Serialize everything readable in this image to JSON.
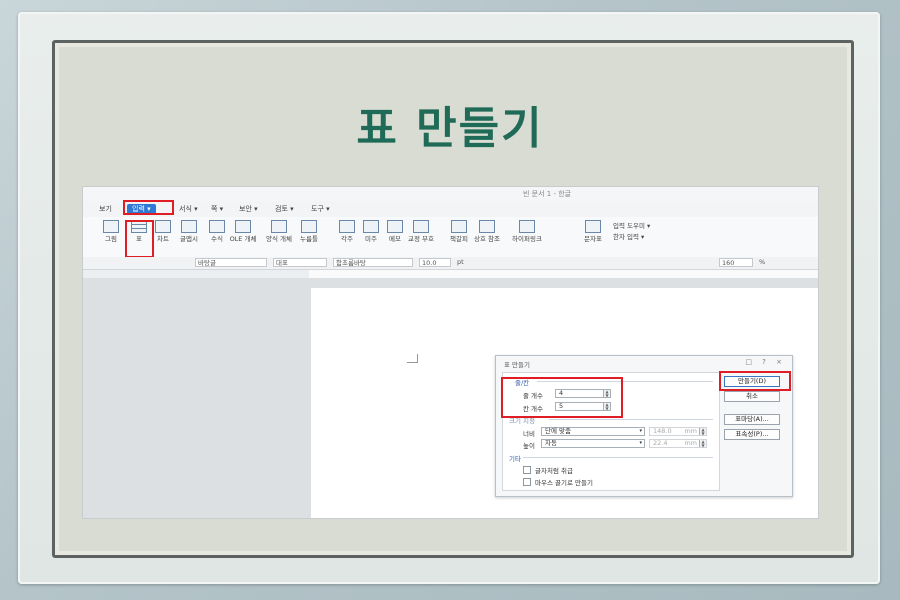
{
  "slide": {
    "title": "표 만들기"
  },
  "window": {
    "title": "빈 문서 1 - 한글"
  },
  "menubar": {
    "items": [
      "보기",
      "입력 ▾",
      "서식 ▾",
      "쪽 ▾",
      "보안 ▾",
      "검토 ▾",
      "도구 ▾"
    ]
  },
  "ribbon": {
    "buttons": [
      {
        "label": "그림",
        "icon": "picture-icon"
      },
      {
        "label": "표",
        "icon": "table-icon"
      },
      {
        "label": "차트",
        "icon": "chart-icon"
      },
      {
        "label": "글맵시",
        "icon": "textart-icon"
      },
      {
        "label": "수식",
        "icon": "formula-icon"
      },
      {
        "label": "OLE 개체",
        "icon": "ole-icon"
      },
      {
        "label": "양식 개체",
        "icon": "form-icon"
      },
      {
        "label": "누름틀",
        "icon": "field-icon"
      },
      {
        "label": "각주",
        "icon": "footnote-icon"
      },
      {
        "label": "미주",
        "icon": "endnote-icon"
      },
      {
        "label": "메모",
        "icon": "memo-icon"
      },
      {
        "label": "교정 부호",
        "icon": "proof-icon"
      },
      {
        "label": "책갈피",
        "icon": "bookmark-icon"
      },
      {
        "label": "상호 참조",
        "icon": "crossref-icon"
      },
      {
        "label": "하이퍼링크",
        "icon": "hyperlink-icon"
      },
      {
        "label": "문자표",
        "icon": "charmap-icon"
      }
    ],
    "side_items": [
      "입력 도우미 ▾",
      "한자 입력 ▾"
    ]
  },
  "formatbar": {
    "style": "바탕글",
    "lang": "대표",
    "font": "함초롬바탕",
    "size": "10.0",
    "unit": "pt",
    "zoom": "160",
    "zoom_unit": "%"
  },
  "dialog": {
    "title": "표 만들기",
    "controls": "□ ? ×",
    "section_rowcol": "줄/칸",
    "row_label": "줄 개수",
    "row_value": "4",
    "col_label": "칸 개수",
    "col_value": "5",
    "section_size": "크기 지정",
    "width_label": "너비",
    "width_mode": "단에 맞춤",
    "width_value": "148.0",
    "width_unit": "mm",
    "height_label": "높이",
    "height_mode": "자동",
    "height_value": "22.4",
    "height_unit": "mm",
    "section_etc": "기타",
    "opt1": "글자처럼 취급",
    "opt2": "마우스 끌기로 만들기",
    "btn_create": "만들기(D)",
    "btn_cancel": "취소",
    "btn_tableshape": "표마당(A)...",
    "btn_props": "표속성(P)..."
  },
  "colors": {
    "title": "#1f6b57",
    "highlight": "#e01c24",
    "menu_active": "#2f79d6"
  }
}
